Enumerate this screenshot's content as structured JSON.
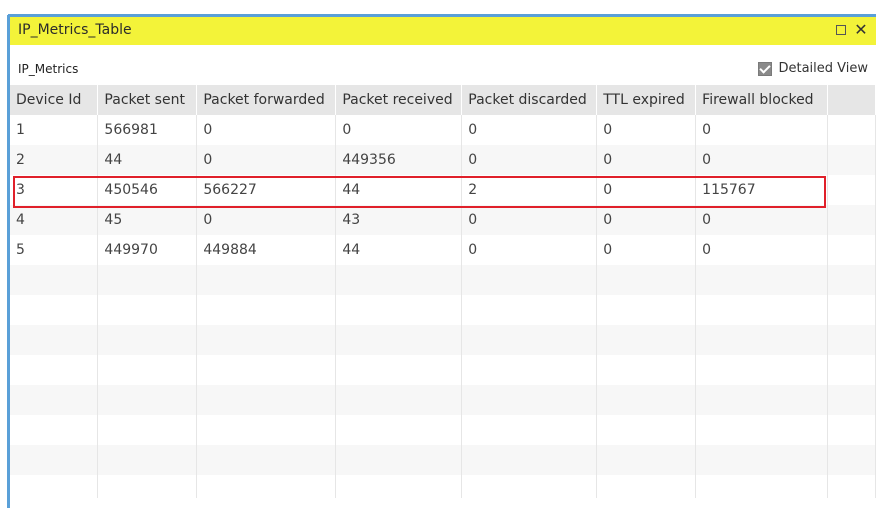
{
  "window": {
    "title": "IP_Metrics_Table",
    "maximize_icon": "square-icon",
    "close_label": "✕"
  },
  "panel": {
    "subtitle": "IP_Metrics",
    "detailed_view_label": "Detailed View",
    "detailed_view_checked": true
  },
  "table": {
    "columns": [
      "Device Id",
      "Packet sent",
      "Packet forwarded",
      "Packet received",
      "Packet discarded",
      "TTL expired",
      "Firewall blocked",
      ""
    ],
    "rows": [
      [
        "1",
        "566981",
        "0",
        "0",
        "0",
        "0",
        "0"
      ],
      [
        "2",
        "44",
        "0",
        "449356",
        "0",
        "0",
        "0"
      ],
      [
        "3",
        "450546",
        "566227",
        "44",
        "2",
        "0",
        "115767"
      ],
      [
        "4",
        "45",
        "0",
        "43",
        "0",
        "0",
        "0"
      ],
      [
        "5",
        "449970",
        "449884",
        "44",
        "0",
        "0",
        "0"
      ]
    ],
    "highlighted_row": "3"
  },
  "colors": {
    "titlebar": "#f3f339",
    "border": "#5aa0d8",
    "highlight": "#e0202a",
    "header_bg": "#e6e6e6"
  }
}
